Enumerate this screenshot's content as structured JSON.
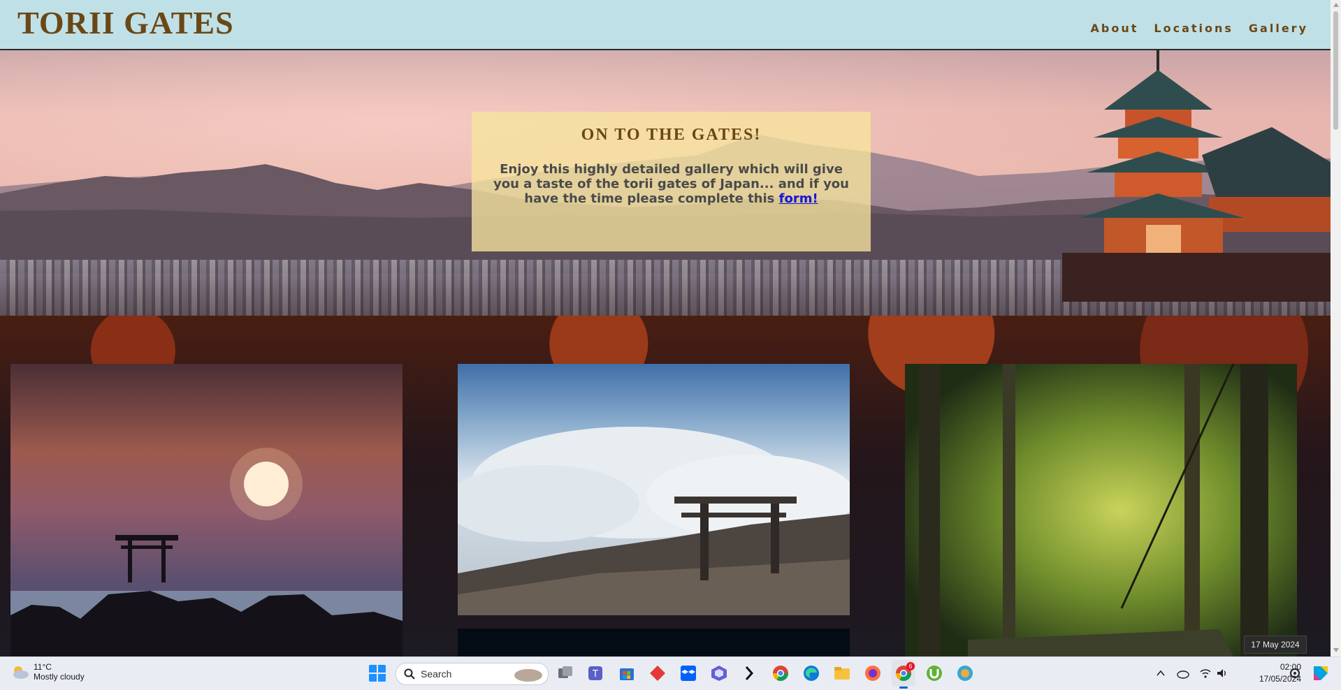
{
  "header": {
    "title": "TORII GATES",
    "nav": [
      {
        "label": "About"
      },
      {
        "label": "Locations"
      },
      {
        "label": "Gallery"
      }
    ]
  },
  "intro": {
    "heading": "ON TO THE GATES!",
    "text": "Enjoy this highly detailed gallery which will give you a taste of the torii gates of Japan... and if you have the time please complete this ",
    "link_label": "form!"
  },
  "tooltip": {
    "date": "17 May 2024"
  },
  "taskbar": {
    "weather_temp": "11°C",
    "weather_desc": "Mostly cloudy",
    "search_placeholder": "Search",
    "time": "02:00",
    "date": "17/05/2024",
    "chrome_badge": "6",
    "icons": [
      "start-icon",
      "search-icon",
      "task-view-icon",
      "teams-icon",
      "store-icon",
      "red-app-icon",
      "dropbox-icon",
      "copilot-icon",
      "terminal-icon",
      "chrome-icon",
      "edge-icon",
      "file-explorer-icon",
      "firefox-icon",
      "chrome-active-icon",
      "utorrent-icon",
      "globe-app-icon"
    ]
  },
  "colors": {
    "header_bg": "#bfe0e7",
    "title_color": "#6b4715",
    "intro_bg": "#f6e49e",
    "link_color": "#1515d6",
    "taskbar_bg": "#e9edf3"
  }
}
